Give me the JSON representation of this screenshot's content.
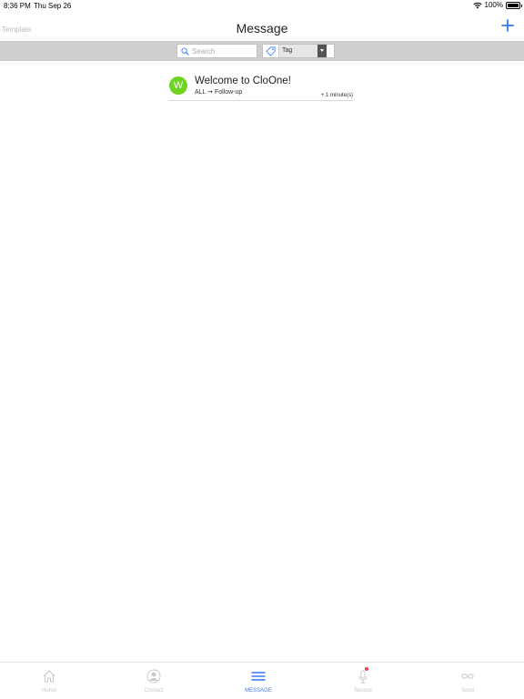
{
  "status_bar": {
    "time": "8:36 PM",
    "date": "Thu Sep 26",
    "battery": "100%"
  },
  "nav": {
    "left_label": "Template",
    "title": "Message"
  },
  "filters": {
    "search_placeholder": "Search",
    "tag_value": "Tag"
  },
  "messages": [
    {
      "avatar_letter": "W",
      "avatar_color": "#6ed321",
      "title": "Welcome to CloOne!",
      "route": "ALL ➞ Follow-up",
      "delay": "+ 1 minute(s)"
    }
  ],
  "tabs": [
    {
      "label": "Home",
      "icon": "home-icon",
      "active": false
    },
    {
      "label": "Contact",
      "icon": "contact-icon",
      "active": false
    },
    {
      "label": "MESSAGE",
      "icon": "message-list-icon",
      "active": true
    },
    {
      "label": "Record",
      "icon": "microphone-icon",
      "active": false
    },
    {
      "label": "Send",
      "icon": "infinity-icon",
      "active": false
    }
  ],
  "colors": {
    "accent": "#3478f6",
    "filter_bar": "#cfcfcf",
    "inactive_tab": "#c8c8c8",
    "record_dot": "#e8453c"
  }
}
